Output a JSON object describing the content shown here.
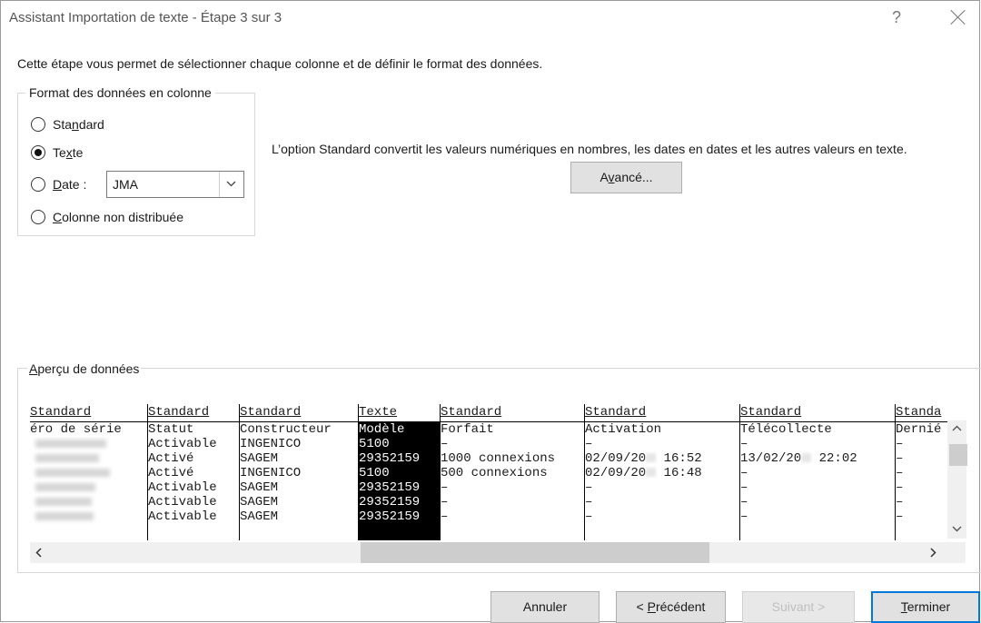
{
  "window": {
    "title": "Assistant Importation de texte - Étape 3 sur 3",
    "help": "?"
  },
  "instruction": "Cette étape vous permet de sélectionner chaque colonne et de définir le format des données.",
  "format_group": {
    "legend": "Format des données en colonne",
    "options": [
      {
        "pre": "Sta",
        "u": "n",
        "post": "dard",
        "checked": false
      },
      {
        "pre": "Te",
        "u": "x",
        "post": "te",
        "checked": true
      },
      {
        "pre": "",
        "u": "D",
        "post": "ate :",
        "checked": false
      },
      {
        "pre": "",
        "u": "C",
        "post": "olonne non distribuée",
        "checked": false
      }
    ],
    "date_format": "JMA"
  },
  "description": "L’option Standard convertit les valeurs numériques en nombres, les dates en dates et les autres valeurs en texte.",
  "advanced_button": {
    "pre": "A",
    "u": "v",
    "post": "ancé..."
  },
  "preview": {
    "legend": {
      "pre": "",
      "u": "A",
      "post": "perçu de données"
    },
    "columns": [
      {
        "header": "Standard",
        "cells": [
          "éro de série",
          "",
          "",
          "",
          "",
          "",
          ""
        ]
      },
      {
        "header": "Standard",
        "cells": [
          "Statut",
          "Activable",
          "Activé",
          "Activé",
          "Activable",
          "Activable",
          "Activable"
        ]
      },
      {
        "header": "Standard",
        "cells": [
          "Constructeur",
          "INGENICO",
          "SAGEM",
          "INGENICO",
          "SAGEM",
          "SAGEM",
          "SAGEM"
        ]
      },
      {
        "header": "Texte",
        "cells": [
          "Modèle",
          "5100",
          "29352159",
          "5100",
          "29352159",
          "29352159",
          "29352159"
        ]
      },
      {
        "header": "Standard",
        "cells": [
          "Forfait",
          "–",
          "1000 connexions",
          "500 connexions",
          "–",
          "–",
          "–"
        ]
      },
      {
        "header": "Standard",
        "cells": [
          "Activation",
          "–",
          "02/09/20",
          "02/09/20",
          "–",
          "–",
          "–"
        ],
        "times": [
          "",
          "",
          "16:52",
          "16:48",
          "",
          "",
          ""
        ]
      },
      {
        "header": "Standard",
        "cells": [
          "Télécollecte",
          "–",
          "13/02/20",
          "–",
          "–",
          "–",
          "–"
        ],
        "times": [
          "",
          "",
          "22:02",
          "",
          "",
          "",
          ""
        ]
      },
      {
        "header": "Standa",
        "cells": [
          "Dernié",
          "–",
          "–",
          "–",
          "–",
          "–",
          "–"
        ]
      }
    ]
  },
  "buttons": {
    "cancel": "Annuler",
    "previous": {
      "pre": "< ",
      "u": "P",
      "post": "récédent"
    },
    "next": "Suivant >",
    "finish": {
      "pre": "",
      "u": "T",
      "post": "erminer"
    }
  }
}
